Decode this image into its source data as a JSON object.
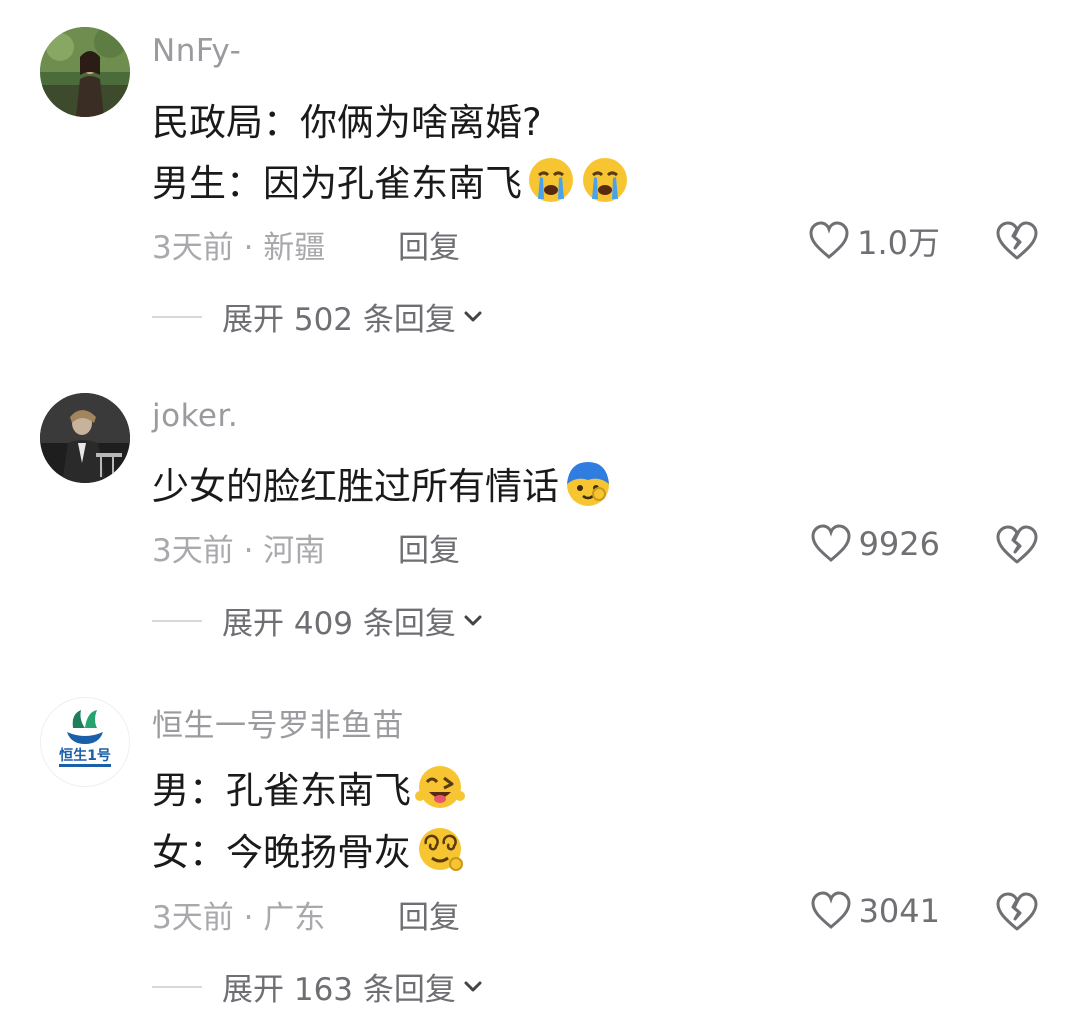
{
  "comments": [
    {
      "username": "NnFy-",
      "lines": [
        "民政局：你俩为啥离婚?",
        "男生：因为孔雀东南飞"
      ],
      "line_emojis": [
        [],
        [
          "crying-face-emoji",
          "crying-face-emoji"
        ]
      ],
      "time_location": "3天前 · 新疆",
      "reply_label": "回复",
      "likes": "1.0万",
      "expand_label": "展开 502 条回复"
    },
    {
      "username": "joker.",
      "lines": [
        "少女的脸红胜过所有情话"
      ],
      "line_emojis": [
        [
          "shy-blue-face-emoji"
        ]
      ],
      "time_location": "3天前 · 河南",
      "reply_label": "回复",
      "likes": "9926",
      "expand_label": "展开 409 条回复"
    },
    {
      "username": "恒生一号罗非鱼苗",
      "lines": [
        "男：孔雀东南飞",
        "女：今晚扬骨灰"
      ],
      "line_emojis": [
        [
          "wink-tongue-face-emoji"
        ],
        [
          "dizzy-face-emoji"
        ]
      ],
      "time_location": "3天前 · 广东",
      "reply_label": "回复",
      "likes": "3041",
      "expand_label": "展开 163 条回复"
    }
  ],
  "colors": {
    "username": "#9a9a9f",
    "meta": "#a9a9ad",
    "reply": "#6e6e73",
    "emoji_yellow": "#f7c531",
    "emoji_blue": "#2f7de1"
  },
  "avatar_logo_text": "恒生1号"
}
